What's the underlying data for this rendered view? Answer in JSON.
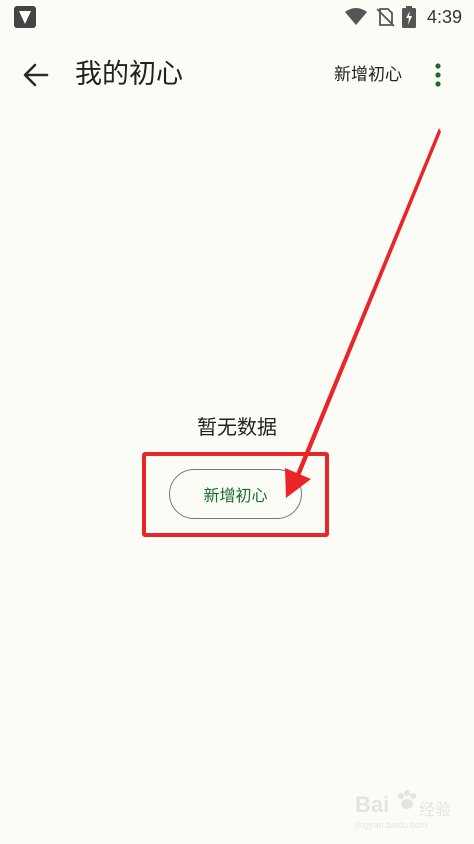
{
  "status_bar": {
    "time": "4:39"
  },
  "app_bar": {
    "title": "我的初心",
    "action_label": "新增初心"
  },
  "empty_state": {
    "message": "暂无数据",
    "button_label": "新增初心"
  },
  "colors": {
    "accent_green": "#1a6b2e",
    "annotation_red": "#e8262a",
    "background": "#fcfcf7"
  },
  "watermark": {
    "logo": "Bai",
    "text": "经验",
    "url": "jingyan.baidu.com"
  }
}
